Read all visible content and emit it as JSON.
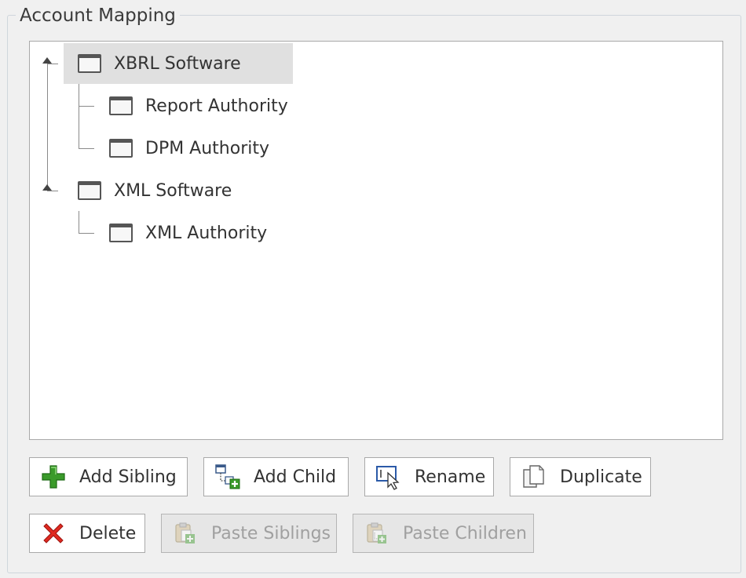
{
  "groupbox": {
    "title": "Account Mapping"
  },
  "tree": {
    "nodes": [
      {
        "label": "XBRL Software",
        "icon": "window-icon",
        "selected": true,
        "expanded": true
      },
      {
        "label": "Report Authority",
        "icon": "window-icon"
      },
      {
        "label": "DPM Authority",
        "icon": "window-icon"
      },
      {
        "label": "XML Software",
        "icon": "window-icon",
        "expanded": true
      },
      {
        "label": "XML Authority",
        "icon": "window-icon"
      }
    ]
  },
  "buttons": {
    "add_sibling": {
      "label": "Add Sibling",
      "icon": "green-plus-icon"
    },
    "add_child": {
      "label": "Add Child",
      "icon": "add-child-icon"
    },
    "rename": {
      "label": "Rename",
      "icon": "rename-cursor-icon"
    },
    "duplicate": {
      "label": "Duplicate",
      "icon": "duplicate-icon"
    },
    "delete": {
      "label": "Delete",
      "icon": "red-x-icon"
    },
    "paste_siblings": {
      "label": "Paste Siblings",
      "icon": "paste-plus-icon",
      "disabled": true
    },
    "paste_children": {
      "label": "Paste Children",
      "icon": "paste-child-icon",
      "disabled": true
    }
  }
}
